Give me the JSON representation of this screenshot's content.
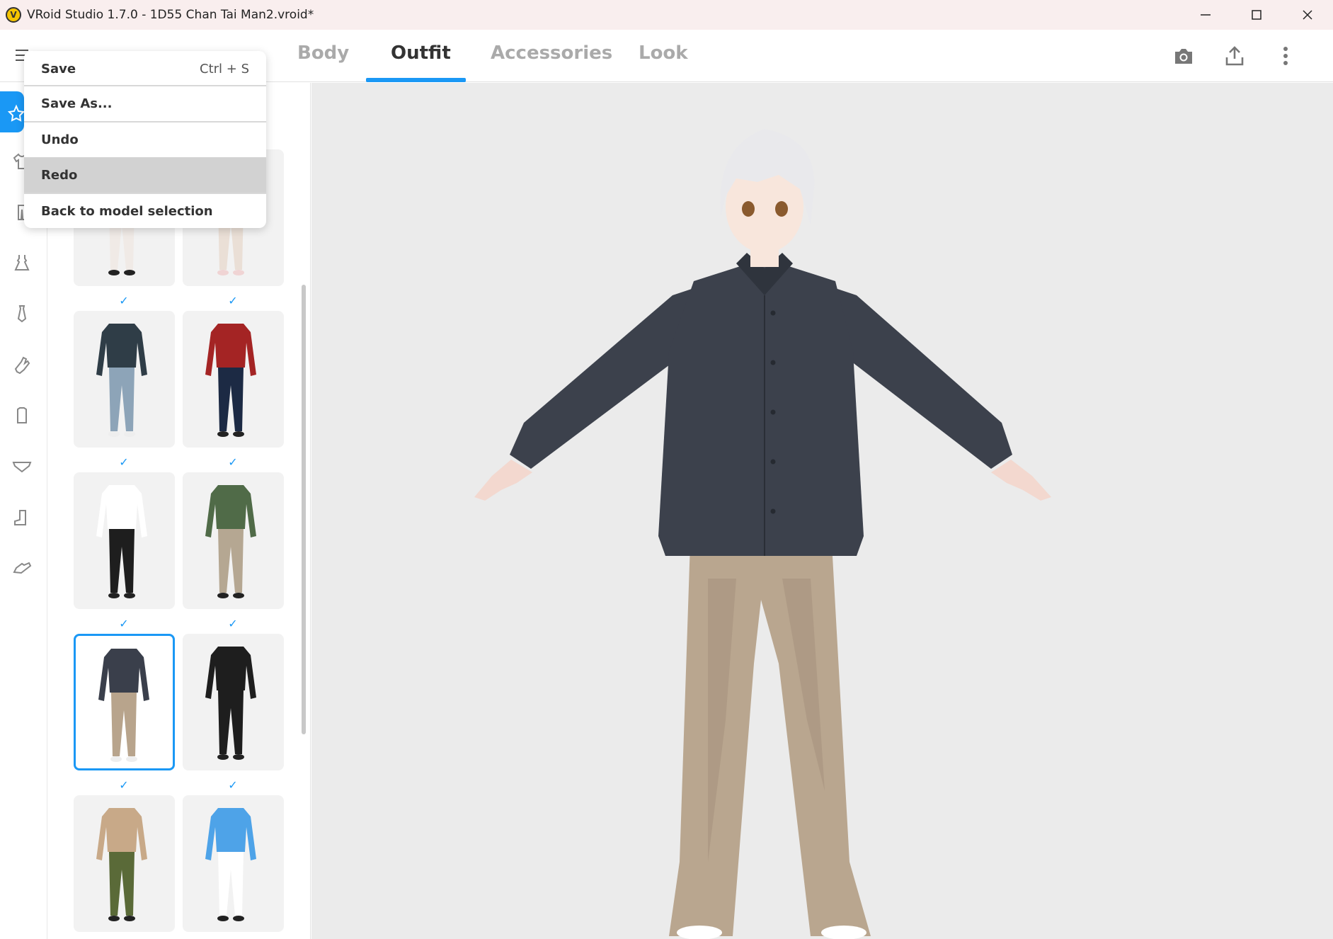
{
  "window": {
    "title": "VRoid Studio 1.7.0 - 1D55 Chan Tai Man2.vroid*",
    "app_icon_glyph": "V",
    "controls": [
      "minimize-icon",
      "maximize-icon",
      "close-icon"
    ]
  },
  "tabs": [
    {
      "label": "Body",
      "active": false
    },
    {
      "label": "Outfit",
      "active": true
    },
    {
      "label": "Accessories",
      "active": false
    },
    {
      "label": "Look",
      "active": false
    }
  ],
  "toolbar_icons": [
    "camera-icon",
    "export-icon",
    "more-vertical-icon"
  ],
  "menu": {
    "items": [
      {
        "label": "Save",
        "shortcut": "Ctrl + S"
      },
      {
        "label": "Save As...",
        "shortcut": ""
      },
      {
        "label": "Undo",
        "shortcut": ""
      },
      {
        "label": "Redo",
        "shortcut": "",
        "highlighted": true
      },
      {
        "label": "Back to model selection",
        "shortcut": ""
      }
    ]
  },
  "rail": {
    "items": [
      "preset-outfit-icon",
      "tops-icon",
      "bottoms-icon",
      "onepiece-icon",
      "tie-icon",
      "gloves-icon",
      "socks-icon",
      "underwear-icon",
      "boots-icon",
      "shoes-icon"
    ],
    "active": "preset-outfit-icon"
  },
  "outfits": [
    {
      "id": "outfit-1",
      "checked": false,
      "colors": {
        "top": "#f0eae6",
        "bottom": "#f0eae6",
        "shoes": "#222"
      }
    },
    {
      "id": "outfit-2",
      "checked": false,
      "colors": {
        "top": "#eadfd6",
        "bottom": "#eadfd6",
        "shoes": "#f0d4d4"
      }
    },
    {
      "id": "outfit-3",
      "checked": true,
      "colors": {
        "top": "#2f3d47",
        "bottom": "#8da4b8",
        "shoes": "#eee"
      }
    },
    {
      "id": "outfit-4",
      "checked": true,
      "colors": {
        "top": "#a42424",
        "bottom": "#1c2a44",
        "shoes": "#222"
      }
    },
    {
      "id": "outfit-5",
      "checked": true,
      "colors": {
        "top": "#ffffff",
        "bottom": "#1e1e1e",
        "shoes": "#222"
      }
    },
    {
      "id": "outfit-6",
      "checked": true,
      "colors": {
        "top": "#506b48",
        "bottom": "#b5a792",
        "shoes": "#222"
      }
    },
    {
      "id": "outfit-7",
      "checked": true,
      "selected": true,
      "colors": {
        "top": "#3a3f4b",
        "bottom": "#b8a48c",
        "shoes": "#eee"
      }
    },
    {
      "id": "outfit-8",
      "checked": true,
      "colors": {
        "top": "#1e1e1e",
        "bottom": "#1e1e1e",
        "shoes": "#222"
      }
    },
    {
      "id": "outfit-9",
      "checked": true,
      "colors": {
        "top": "#c8a988",
        "bottom": "#5a6a38",
        "shoes": "#222"
      }
    },
    {
      "id": "outfit-10",
      "checked": true,
      "colors": {
        "top": "#4ea3e8",
        "bottom": "#ffffff",
        "shoes": "#222"
      }
    }
  ],
  "avatar": {
    "hair_color": "#e9e9ec",
    "skin_color": "#f8e6dc",
    "eye_color": "#8a5a2e",
    "shirt_color": "#3c414c",
    "pants_color": "#b9a68f",
    "shoe_color": "#ffffff"
  },
  "accent_color": "#1a98f5"
}
